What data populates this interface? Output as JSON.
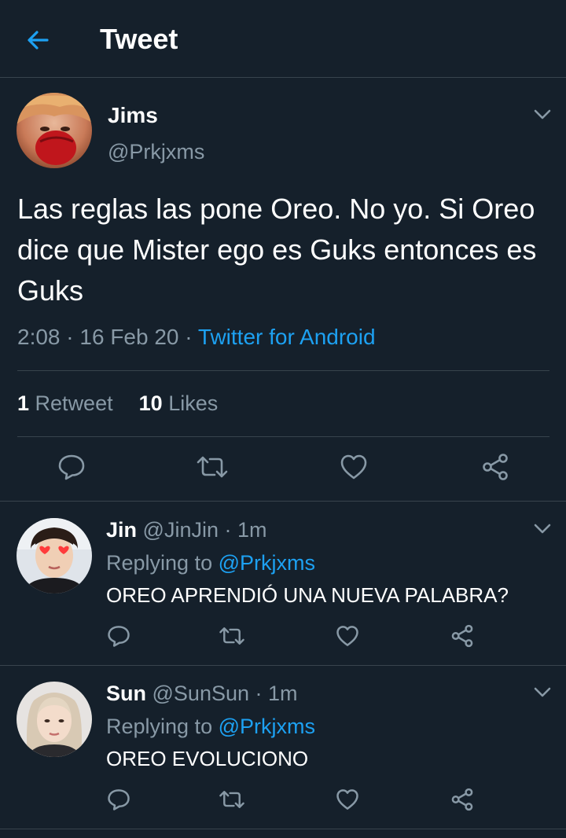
{
  "header": {
    "title": "Tweet"
  },
  "main_tweet": {
    "name": "Jims",
    "handle": "@Prkjxms",
    "text": "Las reglas las pone Oreo. No yo. Si Oreo dice que Mister ego es Guks entonces es Guks",
    "time": "2:08",
    "date": "16 Feb 20",
    "source": "Twitter for Android",
    "retweet_count": "1",
    "retweet_label": "Retweet",
    "like_count": "10",
    "like_label": "Likes"
  },
  "replies": [
    {
      "name": "Jin",
      "handle": "@JinJin",
      "time": "1m",
      "replying_label": "Replying to",
      "replying_to": "@Prkjxms",
      "text": "OREO APRENDIÓ UNA NUEVA PALABRA?"
    },
    {
      "name": "Sun",
      "handle": "@SunSun",
      "time": "1m",
      "replying_label": "Replying to",
      "replying_to": "@Prkjxms",
      "text": "OREO EVOLUCIONO"
    }
  ],
  "icons": {
    "back": "arrow-left-icon",
    "reply": "comment-icon",
    "retweet": "retweet-icon",
    "like": "heart-icon",
    "share": "share-icon",
    "more": "chevron-down-icon"
  },
  "colors": {
    "background": "#15202b",
    "accent": "#1da1f2",
    "secondary_text": "#8899a6",
    "divider": "#38444d"
  }
}
